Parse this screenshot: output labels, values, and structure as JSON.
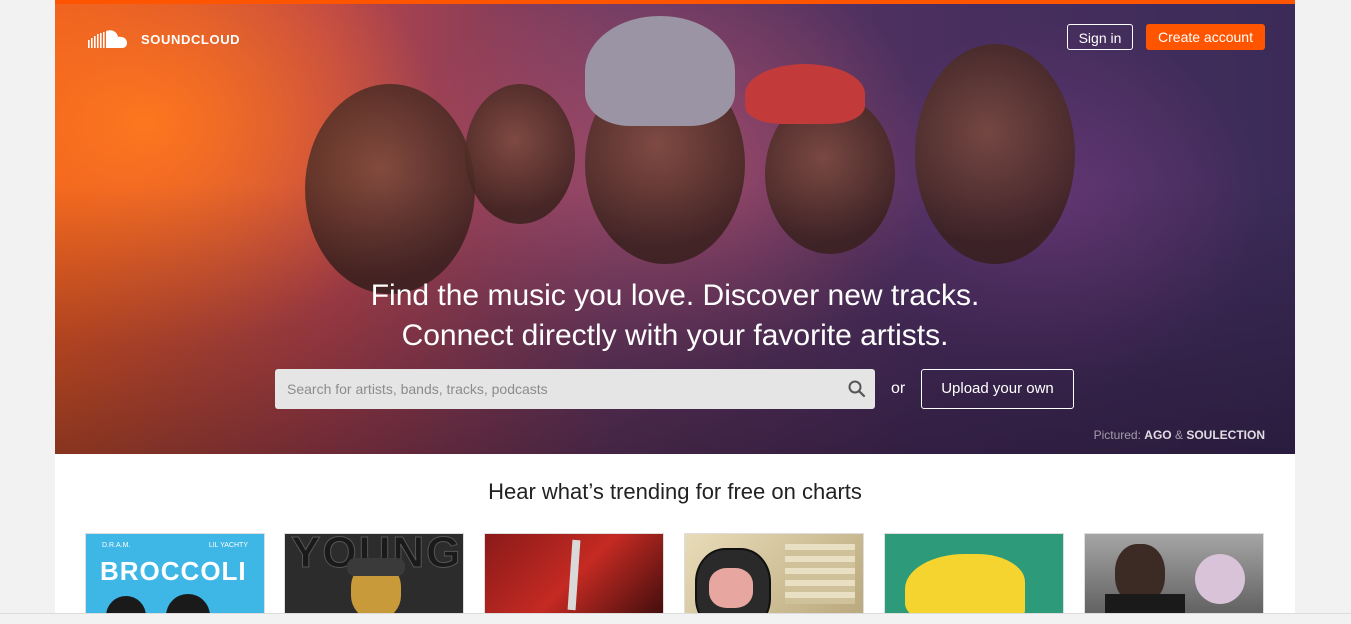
{
  "header": {
    "logo_text": "SOUNDCLOUD",
    "signin_label": "Sign in",
    "create_account_label": "Create account"
  },
  "hero": {
    "headline_line1": "Find the music you love. Discover new tracks.",
    "headline_line2": "Connect directly with your favorite artists.",
    "search_placeholder": "Search for artists, bands, tracks, podcasts",
    "search_value": "",
    "or_text": "or",
    "upload_label": "Upload your own",
    "pictured_prefix": "Pictured:",
    "pictured_artist1": "AGO",
    "pictured_amp": "&",
    "pictured_artist2": "SOULECTION"
  },
  "trending": {
    "title": "Hear what’s trending for free on charts",
    "tiles": [
      {
        "caption_top_left": "D.R.A.M.",
        "caption_top_right": "LIL YACHTY",
        "caption_main": "BROCCOLI",
        "bg": "#3fb7e6"
      },
      {
        "caption_main": "YOUNG",
        "bg": "#2c2c2c"
      },
      {
        "caption_main": "",
        "bg": "#a8201e"
      },
      {
        "caption_main": "",
        "bg": "#d8c59a"
      },
      {
        "caption_main": "",
        "bg": "#2d9a7a"
      },
      {
        "caption_main": "",
        "bg": "#8c8c8c"
      }
    ]
  },
  "colors": {
    "accent": "#ff5500",
    "text_dark": "#222222"
  },
  "icons": {
    "logo": "soundcloud-cloud-icon",
    "search": "search-icon"
  }
}
